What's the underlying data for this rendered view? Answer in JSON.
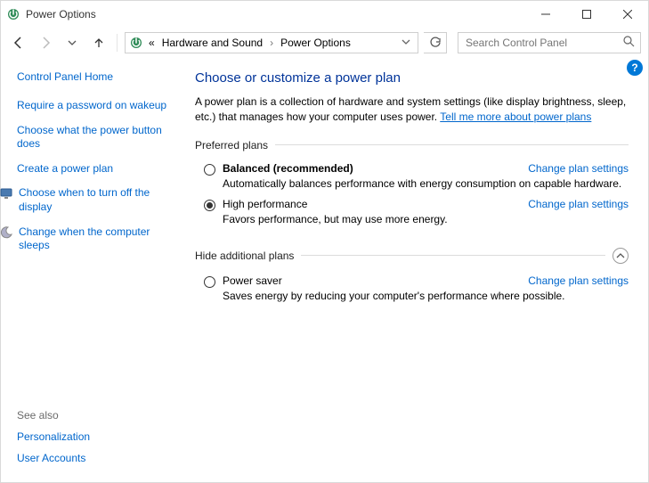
{
  "window": {
    "title": "Power Options"
  },
  "addressbar": {
    "prefix": "«",
    "crumb1": "Hardware and Sound",
    "crumb2": "Power Options"
  },
  "search": {
    "placeholder": "Search Control Panel"
  },
  "sidebar": {
    "home": "Control Panel Home",
    "links": [
      "Require a password on wakeup",
      "Choose what the power button does",
      "Create a power plan",
      "Choose when to turn off the display",
      "Change when the computer sleeps"
    ],
    "see_also_label": "See also",
    "see_also": [
      "Personalization",
      "User Accounts"
    ]
  },
  "main": {
    "heading": "Choose or customize a power plan",
    "description_a": "A power plan is a collection of hardware and system settings (like display brightness, sleep, etc.) that manages how your computer uses power. ",
    "description_link": "Tell me more about power plans",
    "preferred_label": "Preferred plans",
    "hide_label": "Hide additional plans",
    "change_label": "Change plan settings",
    "plans_preferred": [
      {
        "name": "Balanced (recommended)",
        "desc": "Automatically balances performance with energy consumption on capable hardware.",
        "selected": false,
        "bold": true
      },
      {
        "name": "High performance",
        "desc": "Favors performance, but may use more energy.",
        "selected": true,
        "bold": false
      }
    ],
    "plans_additional": [
      {
        "name": "Power saver",
        "desc": "Saves energy by reducing your computer's performance where possible.",
        "selected": false,
        "bold": false
      }
    ]
  }
}
